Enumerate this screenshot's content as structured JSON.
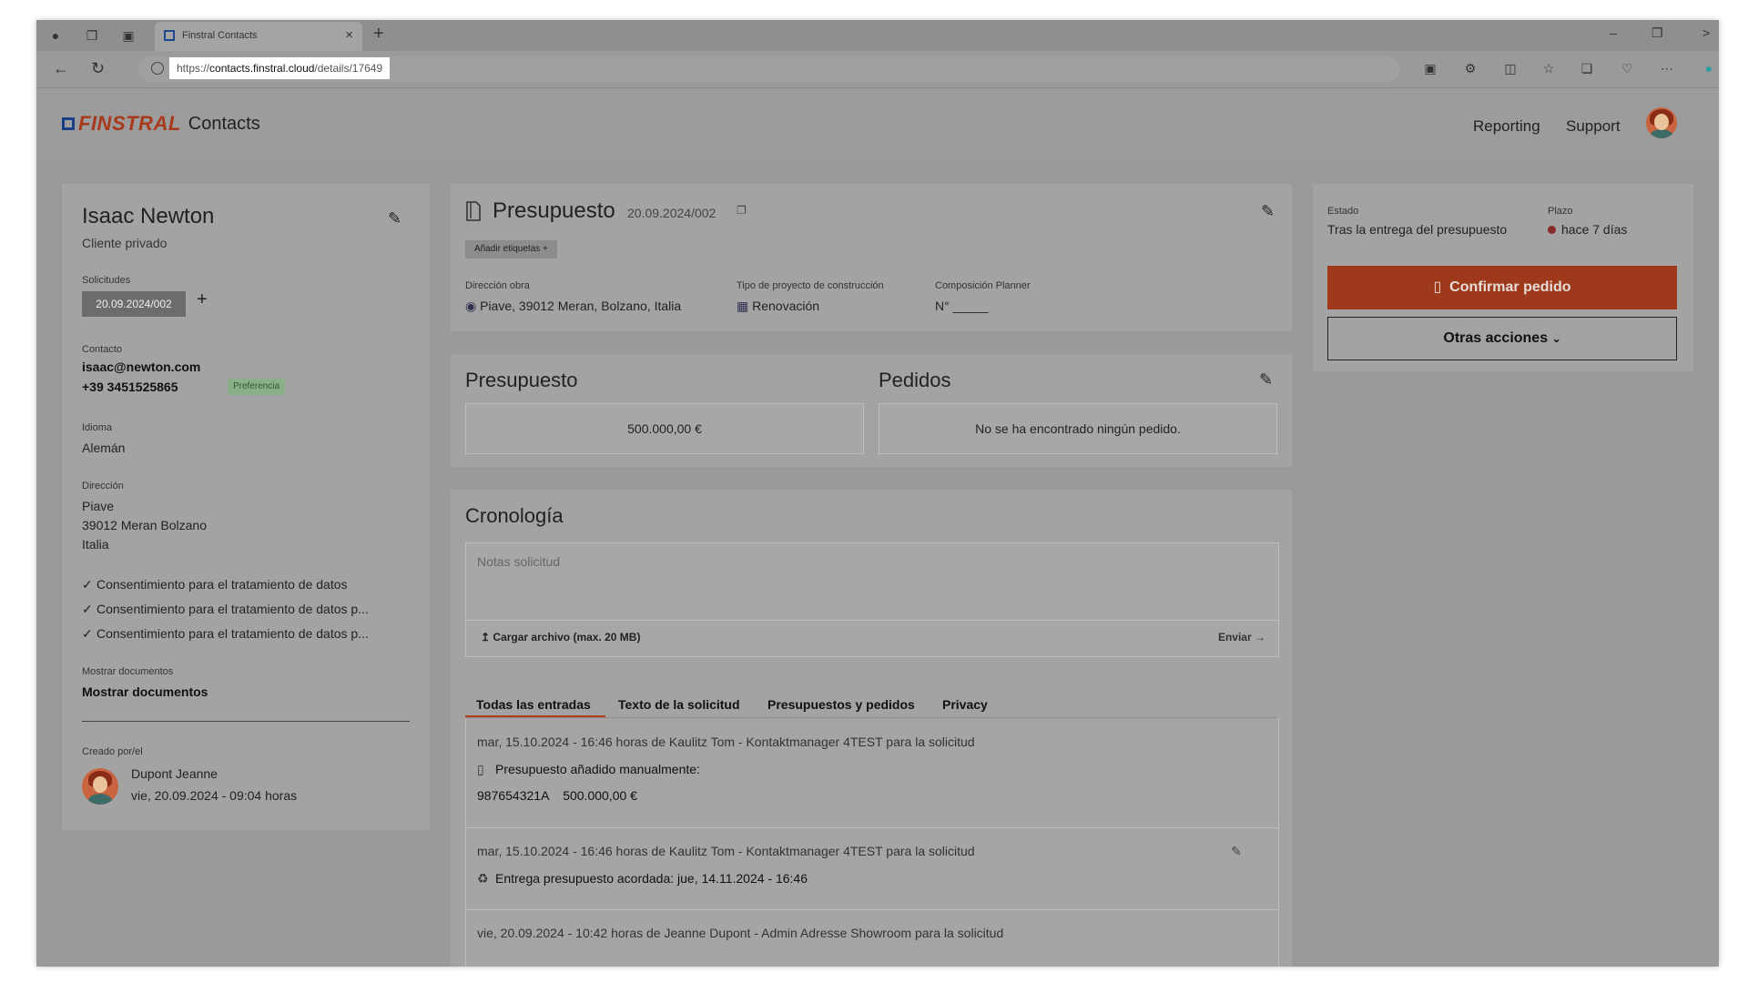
{
  "browser": {
    "tab_title": "Finstral Contacts",
    "url_prefix": "https://",
    "url_host": "contacts.finstral.cloud",
    "url_path": "/details/17649"
  },
  "header": {
    "brand": "FINSTRAL",
    "app_name": "Contacts",
    "nav": [
      "Reporting",
      "Support"
    ]
  },
  "contact": {
    "name": "Isaac Newton",
    "type": "Cliente privado",
    "requests_label": "Solicitudes",
    "request_date": "20.09.2024/002",
    "contact_label": "Contacto",
    "email": "isaac@newton.com",
    "phone": "+39 3451525865",
    "phone_badge": "Preferencia",
    "language_label": "Idioma",
    "language": "Alemán",
    "address_label": "Dirección",
    "address_lines": [
      "Piave",
      "39012 Meran Bolzano",
      "Italia"
    ],
    "consents": [
      "Consentimiento para el tratamiento de datos",
      "Consentimiento para el tratamiento de datos p...",
      "Consentimiento para el tratamiento de datos p..."
    ],
    "documents_label": "Mostrar documentos",
    "documents_link": "Mostrar documentos",
    "created_label": "Creado por/el",
    "created_by": "Dupont Jeanne",
    "created_at": "vie, 20.09.2024 - 09:04 horas"
  },
  "quote": {
    "title": "Presupuesto",
    "number": "20.09.2024/002",
    "add_tags": "Añadir etiquetas +",
    "site_label": "Dirección obra",
    "site_value": "Piave, 39012 Meran, Bolzano, Italia",
    "project_label": "Tipo de proyecto de construcción",
    "project_value": "Renovación",
    "planner_label": "Composición Planner",
    "planner_value": "N° _____"
  },
  "budget": {
    "quote_title": "Presupuesto",
    "quote_value": "500.000,00 €",
    "orders_title": "Pedidos",
    "orders_value": "No se ha encontrado ningún pedido."
  },
  "timeline": {
    "title": "Cronología",
    "notes_placeholder": "Notas solicitud",
    "upload": "Cargar archivo (max. 20 MB)",
    "send": "Enviar →",
    "tabs": [
      "Todas las entradas",
      "Texto de la solicitud",
      "Presupuestos y pedidos",
      "Privacy"
    ],
    "entries": [
      {
        "meta": "mar, 15.10.2024 - 16:46 horas de Kaulitz Tom - Kontaktmanager 4TEST para la solicitud",
        "line1": "Presupuesto añadido manualmente:",
        "line2": "987654321A    500.000,00 €"
      },
      {
        "meta": "mar, 15.10.2024 - 16:46 horas de Kaulitz Tom - Kontaktmanager 4TEST para la solicitud",
        "line1": "Entrega presupuesto acordada: jue, 14.11.2024 - 16:46"
      },
      {
        "meta": "vie, 20.09.2024 - 10:42 horas de Jeanne Dupont - Admin Adresse Showroom para la solicitud"
      }
    ]
  },
  "status": {
    "state_label": "Estado",
    "state_value": "Tras la entrega del presupuesto",
    "deadline_label": "Plazo",
    "deadline_value": "hace 7 días",
    "confirm_button": "Confirmar pedido",
    "other_button": "Otras acciones"
  },
  "colors": {
    "brand_red": "#a8391a",
    "brand_blue": "#1c3f8a",
    "accent": "#9e3a1b"
  }
}
